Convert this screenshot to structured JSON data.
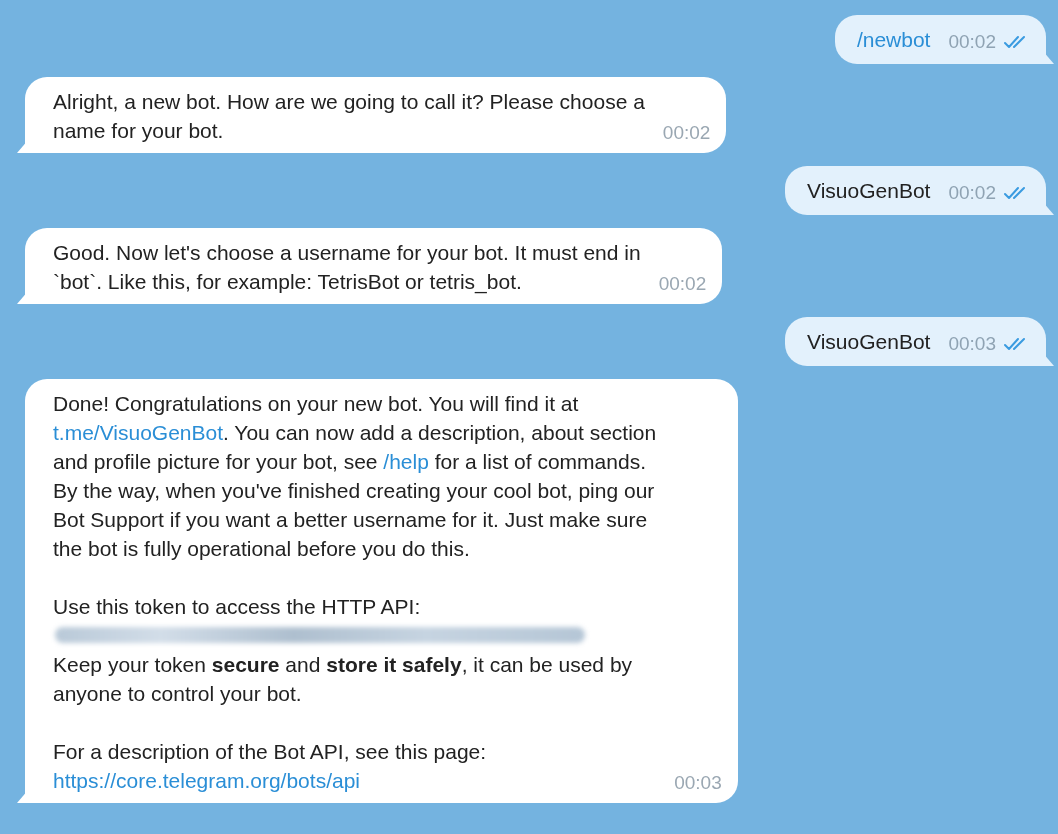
{
  "messages": [
    {
      "kind": "outgoing",
      "blocks": [
        {
          "kind": "paragraph",
          "segments": [
            {
              "kind": "command",
              "text": "/newbot"
            }
          ]
        }
      ],
      "time": "00:02",
      "read": true
    },
    {
      "kind": "incoming",
      "blocks": [
        {
          "kind": "paragraph",
          "segments": [
            {
              "kind": "text",
              "text": "Alright, a new bot. How are we going to call it? Please choose a\nname for your bot."
            }
          ]
        }
      ],
      "time": "00:02"
    },
    {
      "kind": "outgoing",
      "blocks": [
        {
          "kind": "paragraph",
          "segments": [
            {
              "kind": "text",
              "text": "VisuoGenBot"
            }
          ]
        }
      ],
      "time": "00:02",
      "read": true
    },
    {
      "kind": "incoming",
      "blocks": [
        {
          "kind": "paragraph",
          "segments": [
            {
              "kind": "text",
              "text": "Good. Now let's choose a username for your bot. It must end in\n`bot`. Like this, for example: TetrisBot or tetris_bot."
            }
          ]
        }
      ],
      "time": "00:02"
    },
    {
      "kind": "outgoing",
      "blocks": [
        {
          "kind": "paragraph",
          "segments": [
            {
              "kind": "text",
              "text": "VisuoGenBot"
            }
          ]
        }
      ],
      "time": "00:03",
      "read": true
    },
    {
      "kind": "incoming",
      "blocks": [
        {
          "kind": "paragraph",
          "segments": [
            {
              "kind": "text",
              "text": "Done! Congratulations on your new bot. You will find it at\n"
            },
            {
              "kind": "link",
              "text": "t.me/VisuoGenBot"
            },
            {
              "kind": "text",
              "text": ". You can now add a description, about section\nand profile picture for your bot, see "
            },
            {
              "kind": "link",
              "text": "/help"
            },
            {
              "kind": "text",
              "text": " for a list of commands.\nBy the way, when you've finished creating your cool bot, ping our\nBot Support if you want a better username for it. Just make sure\nthe bot is fully operational before you do this."
            }
          ]
        },
        {
          "kind": "paragraph",
          "segments": [
            {
              "kind": "text",
              "text": "Use this token to access the HTTP API:"
            }
          ]
        },
        {
          "kind": "redacted"
        },
        {
          "kind": "paragraph",
          "segments": [
            {
              "kind": "text",
              "text": "Keep your token **secure** and **store it safely**, it can be used by\nanyone to control your bot."
            }
          ]
        },
        {
          "kind": "paragraph",
          "segments": [
            {
              "kind": "text",
              "text": "For a description of the Bot API, see this page:\n"
            },
            {
              "kind": "link",
              "text": "https://core.telegram.org/bots/api"
            }
          ]
        }
      ],
      "time": "00:03"
    }
  ]
}
